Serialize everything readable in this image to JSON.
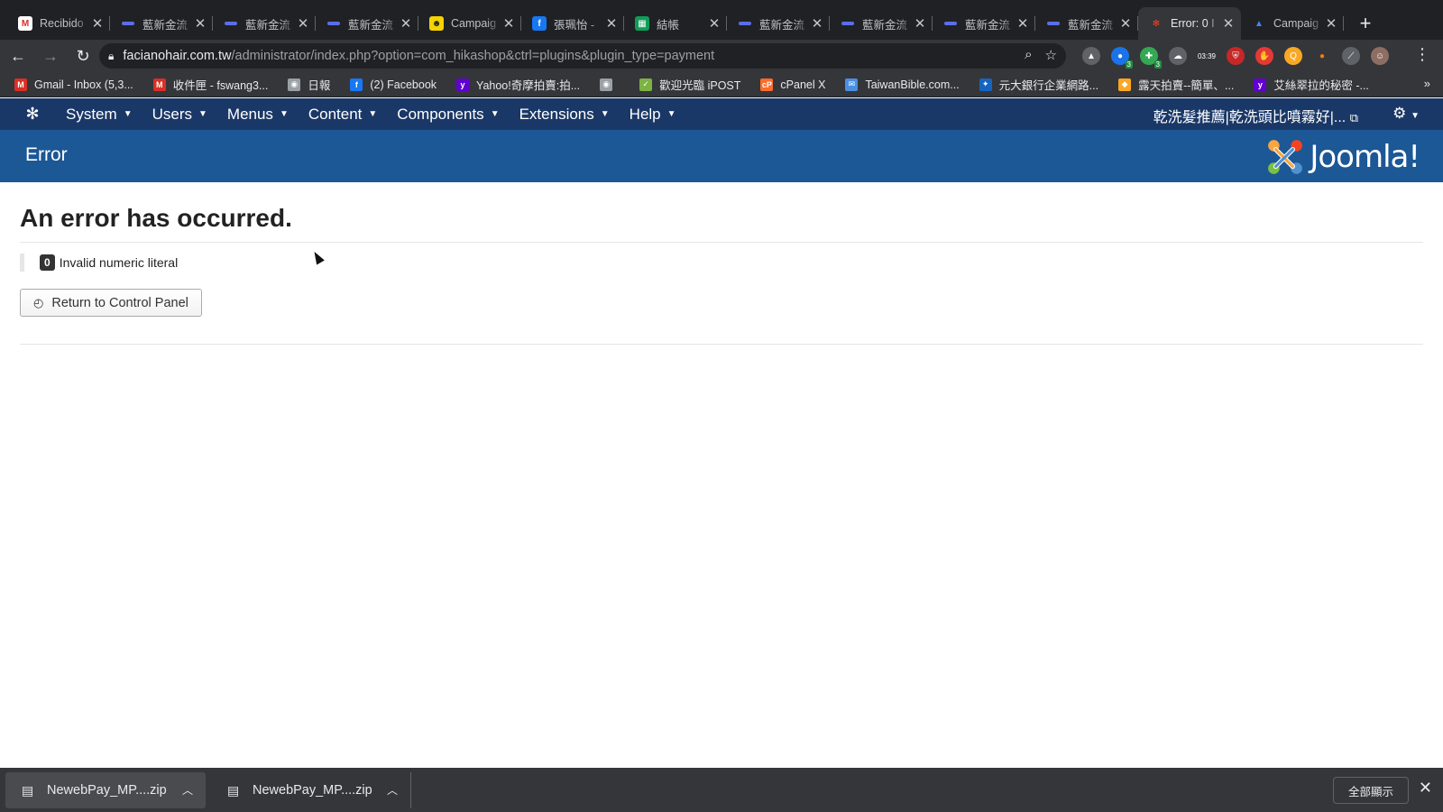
{
  "browser": {
    "tabs": [
      {
        "label": "Recibido",
        "favicon": "gmail",
        "active": false
      },
      {
        "label": "藍新金流",
        "favicon": "line",
        "active": false
      },
      {
        "label": "藍新金流",
        "favicon": "line",
        "active": false
      },
      {
        "label": "藍新金流",
        "favicon": "line",
        "active": false
      },
      {
        "label": "Campaig",
        "favicon": "mailchimp",
        "active": false
      },
      {
        "label": "張珮怡 - ",
        "favicon": "facebook",
        "active": false
      },
      {
        "label": "結帳",
        "favicon": "sheet",
        "active": false
      },
      {
        "label": "藍新金流",
        "favicon": "line",
        "active": false
      },
      {
        "label": "藍新金流",
        "favicon": "line",
        "active": false
      },
      {
        "label": "藍新金流",
        "favicon": "line",
        "active": false
      },
      {
        "label": "藍新金流",
        "favicon": "line",
        "active": false
      },
      {
        "label": "Error: 0 I",
        "favicon": "joomla",
        "active": true
      },
      {
        "label": "Campaig",
        "favicon": "google-ads",
        "active": false
      }
    ],
    "url_host": "facianohair.com.tw",
    "url_path": "/administrator/index.php?option=com_hikashop&ctrl=plugins&plugin_type=payment",
    "extension_badges": [
      "3",
      "3",
      "03:39"
    ],
    "bookmarks": [
      {
        "label": "Gmail - Inbox (5,3...",
        "icon": "gmail",
        "color": "#d93025"
      },
      {
        "label": "收件匣 - fswang3...",
        "icon": "gmail",
        "color": "#d93025"
      },
      {
        "label": "日報",
        "icon": "globe",
        "color": "#9aa0a6"
      },
      {
        "label": "(2) Facebook",
        "icon": "facebook",
        "color": "#1877f2"
      },
      {
        "label": "Yahoo!奇摩拍賣:拍...",
        "icon": "yahoo",
        "color": "#6001d2"
      },
      {
        "label": "",
        "icon": "globe",
        "color": "#9aa0a6"
      },
      {
        "label": "歡迎光臨 iPOST",
        "icon": "ipost",
        "color": "#7cb342"
      },
      {
        "label": "cPanel X",
        "icon": "cpanel",
        "color": "#ff6c2c"
      },
      {
        "label": "TaiwanBible.com...",
        "icon": "mail",
        "color": "#4a90e2"
      },
      {
        "label": "元大銀行企業網路...",
        "icon": "bank",
        "color": "#1565c0"
      },
      {
        "label": "露天拍賣--簡單、...",
        "icon": "ruten",
        "color": "#f9a825"
      },
      {
        "label": "艾絲翠拉的秘密 -...",
        "icon": "yahoo",
        "color": "#6001d2"
      }
    ],
    "more_bookmarks": "»"
  },
  "joomla": {
    "menu": [
      "System",
      "Users",
      "Menus",
      "Content",
      "Components",
      "Extensions",
      "Help"
    ],
    "site_name": "乾洗髮推薦|乾洗頭比噴霧好|...",
    "page_title": "Error",
    "brand": "Joomla!"
  },
  "error": {
    "heading": "An error has occurred.",
    "code": "0",
    "message": "Invalid numeric literal",
    "return_label": "Return to Control Panel"
  },
  "downloads": {
    "items": [
      "NewebPay_MP....zip",
      "NewebPay_MP....zip"
    ],
    "show_all": "全部顯示"
  },
  "colors": {
    "joomla_nav": "#1a3867",
    "joomla_header": "#1c5796"
  }
}
